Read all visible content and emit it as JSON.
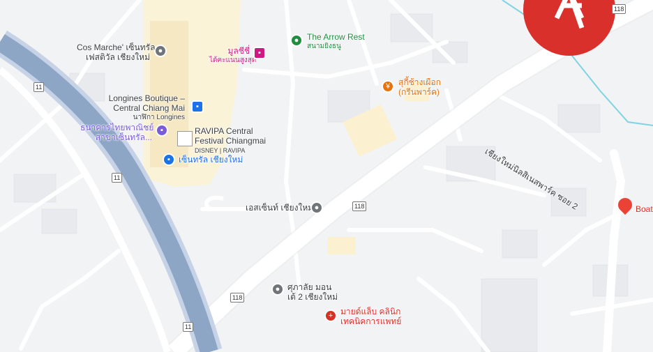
{
  "places": {
    "cos_marche": [
      "Cos Marche' เซ็นทรัล",
      "เฟสติวัล เชียงใหม่"
    ],
    "arrow_rest": [
      "The Arrow Rest",
      "สนามยิงธนู"
    ],
    "mulchi": [
      "มูลชีชี่",
      "ได้คะแนนสูงสุด"
    ],
    "longines": [
      "Longines Boutique –",
      "Central Chiang Mai",
      "นาฬิกา Longines"
    ],
    "thai_bank": [
      "ธนาคารไทยพาณิชย์",
      "สาขาเซ็นทรัล..."
    ],
    "ravipa": [
      "RAVIPA Central",
      "Festival Chiangmai",
      "DISNEY | RAVIPA"
    ],
    "central": "เซ็นทรัล เชียงใหม่",
    "suki": [
      "สุกี้ช้างเผือก",
      "(กรีนพาร์ค)"
    ],
    "s_central": "เอสเซ็นท์ เชียงใหม่",
    "kasalai": [
      "ศุภาลัย มอน",
      "เต้ 2 เชียงใหม่"
    ],
    "mind_lab": [
      "มายด์แล็บ คลินิก",
      "เทคนิคการแพทย์"
    ],
    "boat": "Boat",
    "road_thai": "เชียงใหม่นิลสิเนสพาร์ค ซอย 2"
  },
  "shields": [
    "11",
    "11",
    "11",
    "118",
    "118",
    "118"
  ],
  "icons": [
    "place-icon",
    "restaurant-icon",
    "hotel-icon",
    "shopping-icon",
    "bank-icon",
    "hospital-icon",
    "red-pin-icon",
    "brand-logo"
  ],
  "colors": {
    "highway": "#8ea6c6",
    "road": "#ffffff",
    "land": "#f1f3f4",
    "building": "#e8eaed",
    "water": "#7fd3e3",
    "logo": "#d9302c"
  }
}
